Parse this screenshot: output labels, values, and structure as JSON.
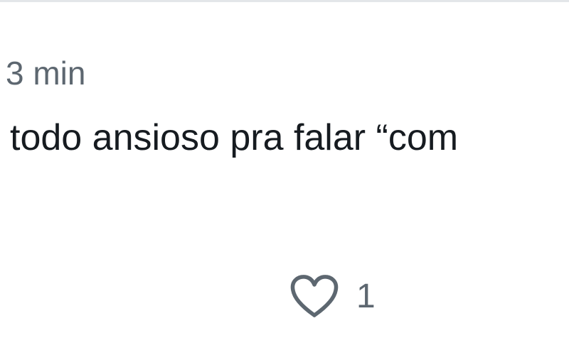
{
  "post": {
    "timestamp": "3 min",
    "text": "todo ansioso pra falar “com",
    "like_icon": "heart-icon",
    "like_count": "1"
  },
  "colors": {
    "text": "#161b20",
    "muted": "#5d6770",
    "border": "#e3e6e9",
    "background": "#ffffff"
  }
}
